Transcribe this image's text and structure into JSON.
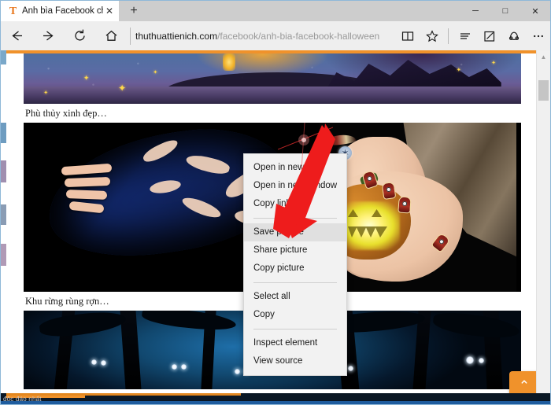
{
  "window": {
    "controls": {
      "minimize": "─",
      "maximize": "□",
      "close": "✕"
    }
  },
  "tabstrip": {
    "tab": {
      "favicon": "T",
      "favicon_icon": "site-favicon-letter-t",
      "title": "Ảnh bìa Facebook chủ đ",
      "close": "✕"
    },
    "new_tab_label": "+"
  },
  "navbar": {
    "back_icon": "back-arrow-icon",
    "forward_icon": "forward-arrow-icon",
    "refresh_icon": "refresh-icon",
    "home_icon": "home-icon",
    "url_host": "thuthuattienich.com",
    "url_path": "/facebook/anh-bia-facebook-halloween",
    "tools": [
      {
        "name": "reading-view-icon",
        "label": "Reading view"
      },
      {
        "name": "favorites-star-icon",
        "label": "Add to favorites"
      },
      {
        "name": "hub-icon",
        "label": "Hub"
      },
      {
        "name": "web-note-icon",
        "label": "Make a Web Note"
      },
      {
        "name": "share-icon",
        "label": "Share"
      },
      {
        "name": "more-icon",
        "label": "…"
      }
    ]
  },
  "page": {
    "caption_1": "Phù thủy xinh đẹp…",
    "caption_2": "Khu rừng rùng rợn…",
    "banner_alt": "halloween-night-banner",
    "main_image_alt": "witch-holding-glowing-pumpkin",
    "forest_image_alt": "spooky-forest-with-glowing-eyes",
    "to_top_icon": "⌃",
    "accent_color": "#f0922b"
  },
  "scrollbar": {
    "up_arrow": "▲",
    "down_arrow": "▼"
  },
  "status_strip": {
    "text": "độc đáo nhất"
  },
  "context_menu": {
    "items": [
      {
        "label": "Open in new tab",
        "selected": false,
        "type": "item"
      },
      {
        "label": "Open in new window",
        "selected": false,
        "type": "item"
      },
      {
        "label": "Copy link",
        "selected": false,
        "type": "item"
      },
      {
        "type": "separator"
      },
      {
        "label": "Save picture",
        "selected": true,
        "type": "item"
      },
      {
        "label": "Share picture",
        "selected": false,
        "type": "item"
      },
      {
        "label": "Copy picture",
        "selected": false,
        "type": "item"
      },
      {
        "type": "separator"
      },
      {
        "label": "Select all",
        "selected": false,
        "type": "item"
      },
      {
        "label": "Copy",
        "selected": false,
        "type": "item"
      },
      {
        "type": "separator"
      },
      {
        "label": "Inspect element",
        "selected": false,
        "type": "item"
      },
      {
        "label": "View source",
        "selected": false,
        "type": "item"
      }
    ],
    "highlight_color": "#e0e0e0",
    "background_color": "#f2f2f2"
  },
  "annotation": {
    "arrow_color": "#ee1c1c",
    "arrow_name": "red-pointer-arrow",
    "points_to": "Save picture"
  }
}
